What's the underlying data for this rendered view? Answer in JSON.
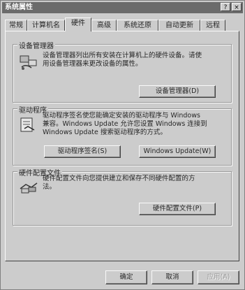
{
  "window": {
    "title": "系统属性"
  },
  "titlebar": {
    "help_label": "?",
    "close_label": "×"
  },
  "tabs": [
    {
      "label": "常规"
    },
    {
      "label": "计算机名"
    },
    {
      "label": "硬件"
    },
    {
      "label": "高级"
    },
    {
      "label": "系统还原"
    },
    {
      "label": "自动更新"
    },
    {
      "label": "远程"
    }
  ],
  "device_manager": {
    "title": "设备管理器",
    "description_line1": "设备管理器列出所有安装在计算机上的硬件设备。请使",
    "description_line2": "用设备管理器来更改设备的属性。",
    "button_label": "设备管理器(D)"
  },
  "drivers": {
    "title": "驱动程序",
    "description_line1": "驱动程序签名使您能确定安装的驱动程序与 Windows",
    "description_line2": "兼容。Windows Update 允许您设置 Windows 连接到",
    "description_line3": "Windows Update 搜索驱动程序的方式。",
    "signing_button_label": "驱动程序签名(S)",
    "update_button_label": "Windows Update(W)"
  },
  "hardware_profiles": {
    "title": "硬件配置文件",
    "description_line1": "硬件配置文件向您提供建立和保存不同硬件配置的方",
    "description_line2": "法。",
    "button_label": "硬件配置文件(P)"
  },
  "footer": {
    "ok_label": "确定",
    "cancel_label": "取消",
    "apply_label": "应用(A)"
  }
}
